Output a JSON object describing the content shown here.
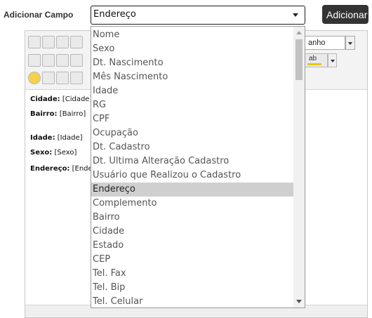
{
  "form": {
    "label": "Adicionar Campo",
    "selected_value": "Endereço",
    "add_button": "Adicionar"
  },
  "editor": {
    "font_size_combo": "anho",
    "color_button_label": "ab",
    "content": [
      {
        "label": "Cidade:",
        "value": "[Cidade]"
      },
      {
        "label": "Bairro:",
        "value": "[Bairro]"
      },
      {
        "label": "Idade:",
        "value": "[Idade]"
      },
      {
        "label": "Sexo:",
        "value": "[Sexo]"
      },
      {
        "label": "Endereço:",
        "value": "[Ende"
      }
    ]
  },
  "dropdown": {
    "options": [
      "Nome",
      "Sexo",
      "Dt. Nascimento",
      "Mês Nascimento",
      "Idade",
      "RG",
      "CPF",
      "Ocupação",
      "Dt. Cadastro",
      "Dt. Ultima Alteração Cadastro",
      "Usuário que Realizou o Cadastro",
      "Endereço",
      "Complemento",
      "Bairro",
      "Cidade",
      "Estado",
      "CEP",
      "Tel. Fax",
      "Tel. Bip",
      "Tel. Celular"
    ],
    "selected_index": 11
  },
  "colors": {
    "button_bg": "#333333",
    "selected_option_bg": "#cfcfcf"
  }
}
